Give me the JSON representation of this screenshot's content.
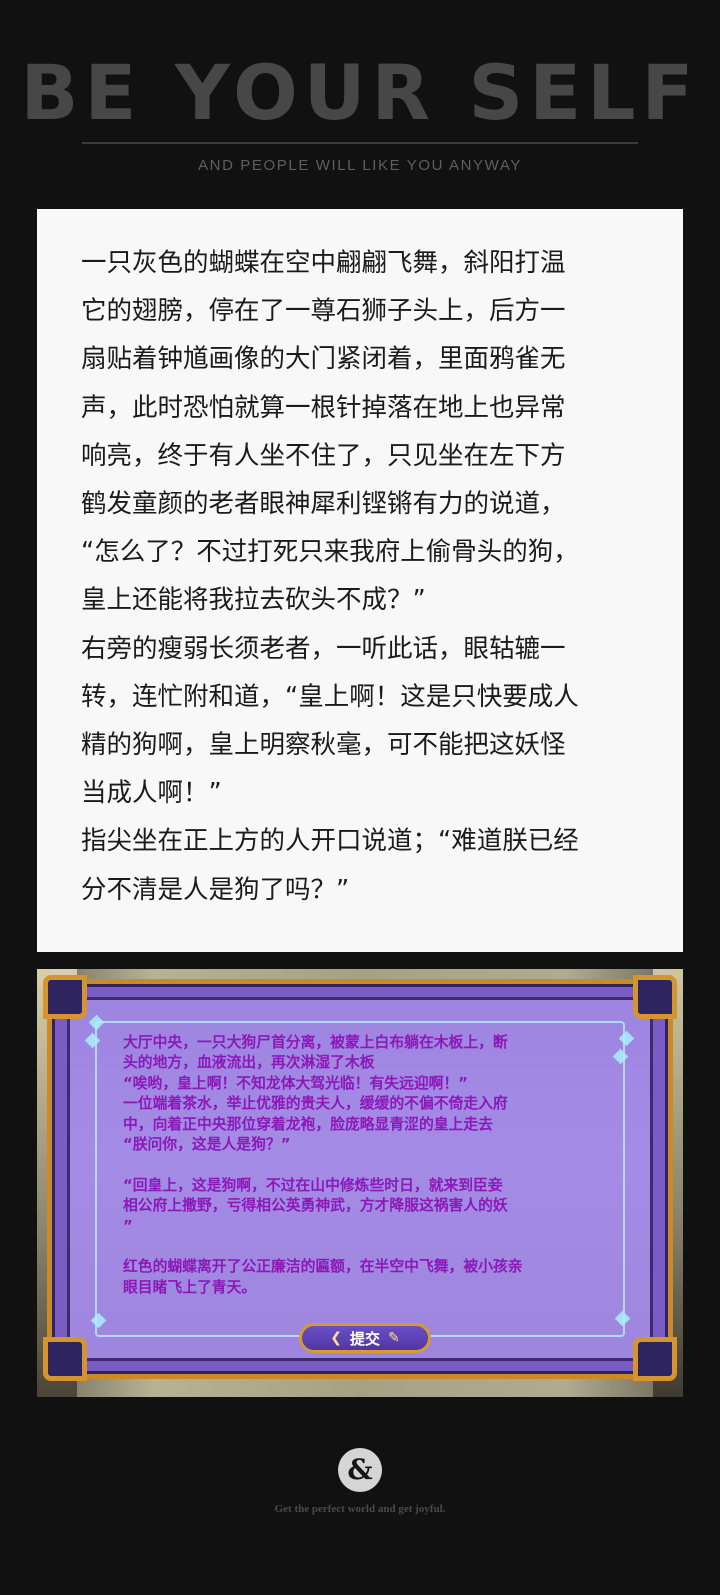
{
  "header": {
    "title": "BE YOUR SELF",
    "subtitle": "AND PEOPLE WILL LIKE YOU ANYWAY"
  },
  "story": {
    "text": "一只灰色的蝴蝶在空中翩翩飞舞，斜阳打温\n它的翅膀，停在了一尊石狮子头上，后方一\n扇贴着钟馗画像的大门紧闭着，里面鸦雀无\n声，此时恐怕就算一根针掉落在地上也异常\n响亮，终于有人坐不住了，只见坐在左下方\n鹤发童颜的老者眼神犀利铿锵有力的说道，\n“怎么了？不过打死只来我府上偷骨头的狗，\n皇上还能将我拉去砍头不成？”\n右旁的瘦弱长须老者，一听此话，眼轱辘一\n转，连忙附和道，“皇上啊！这是只快要成人\n精的狗啊，皇上明察秋毫，可不能把这妖怪\n当成人啊！”\n指尖坐在正上方的人开口说道；“难道朕已经\n分不清是人是狗了吗？”"
  },
  "game_dialog": {
    "text": "大厅中央，一只大狗尸首分离，被蒙上白布躺在木板上，断\n头的地方，血液流出，再次淋湿了木板\n“唉哟，皇上啊！不知龙体大驾光临！有失远迎啊！”\n一位端着茶水，举止优雅的贵夫人，缓缓的不偏不倚走入府\n中，向着正中央那位穿着龙袍，脸庞略显青涩的皇上走去\n“朕问你，这是人是狗？”\n\n“回皇上，这是狗啊，不过在山中修炼些时日，就来到臣妾\n相公府上撒野，亏得相公英勇神武，方才降服这祸害人的妖\n”\n\n红色的蝴蝶离开了公正廉洁的匾额，在半空中飞舞，被小孩亲\n眼目睹飞上了青天。",
    "submit_label": "提交"
  },
  "footer": {
    "ampersand": "&",
    "tagline": "Get the perfect world and get joyful."
  },
  "colors": {
    "page_background": "#111111",
    "header_text": "#474747",
    "dialog_text": "#8d18b8",
    "frame_gold": "#c98a2b",
    "frame_purple": "#a48ce6"
  }
}
